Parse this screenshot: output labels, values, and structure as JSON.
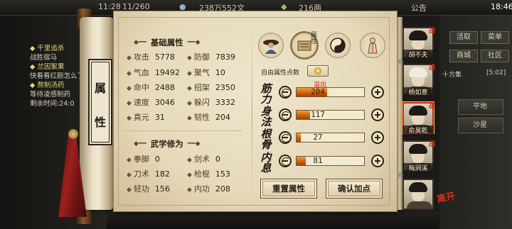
{
  "topbar": {
    "time_left": "11:28",
    "food": "11/260",
    "money": "238万552文",
    "gems": "216两",
    "notice": "公告",
    "clock": "18:46"
  },
  "quests": [
    {
      "text": "◆ 千里追杀",
      "highlight": true
    },
    {
      "text": "战胜宿马",
      "highlight": false
    },
    {
      "text": "◆ 兰因絮果",
      "highlight": true
    },
    {
      "text": "快看看红颜怎么了",
      "highlight": false
    },
    {
      "text": "◆ 熬制汤药",
      "highlight": true
    },
    {
      "text": "等待凌感制药",
      "highlight": false
    },
    {
      "text": "剩余时间:24:0",
      "highlight": false
    }
  ],
  "right_menu": {
    "buttons": [
      "活取",
      "菜单",
      "商城",
      "社区"
    ],
    "sub": [
      "十方集",
      "[5:02]"
    ],
    "locations": [
      "平地",
      "沙星"
    ]
  },
  "panel": {
    "title_chars": [
      "属",
      "性"
    ],
    "basic_title": "基础属性",
    "martial_title": "武学修为",
    "basic_stats": [
      {
        "label": "攻击",
        "value": "5778"
      },
      {
        "label": "防御",
        "value": "7839"
      },
      {
        "label": "气血",
        "value": "19492"
      },
      {
        "label": "聚气",
        "value": "10"
      },
      {
        "label": "命中",
        "value": "2488"
      },
      {
        "label": "招架",
        "value": "2350"
      },
      {
        "label": "速度",
        "value": "3046"
      },
      {
        "label": "躲闪",
        "value": "3332"
      },
      {
        "label": "真元",
        "value": "31"
      },
      {
        "label": "韧性",
        "value": "204"
      }
    ],
    "martial_stats": [
      {
        "label": "拳脚",
        "value": "0"
      },
      {
        "label": "剑术",
        "value": "0"
      },
      {
        "label": "刀术",
        "value": "182"
      },
      {
        "label": "枪棍",
        "value": "153"
      },
      {
        "label": "轻功",
        "value": "156"
      },
      {
        "label": "内功",
        "value": "208"
      }
    ],
    "tabs": [
      "人物",
      "属性",
      "武学",
      "经脉"
    ],
    "active_tab_label": "属性",
    "free_points_label": "自由属性点数",
    "overflow_label": "溢出",
    "attributes": [
      {
        "name": "筋力",
        "value": "204",
        "fill": 0.45
      },
      {
        "name": "身法",
        "value": "117",
        "fill": 0.2
      },
      {
        "name": "根骨",
        "value": "27",
        "fill": 0.06
      },
      {
        "name": "内息",
        "value": "81",
        "fill": 0.14
      }
    ],
    "reset_button": "重置属性",
    "confirm_button": "确认加点"
  },
  "roster": [
    {
      "name": "胡不夫",
      "mark": "战",
      "role": "侍"
    },
    {
      "name": "杨如意",
      "mark": "战",
      "role": ""
    },
    {
      "name": "俞昊乾",
      "mark": "战",
      "role": "",
      "selected": true
    },
    {
      "name": "梅涧溪",
      "mark": "战",
      "role": "侍"
    },
    {
      "name": "",
      "mark": "",
      "role": ""
    }
  ],
  "leave_label": "离开",
  "colors": {
    "bar_fill": "#d0600f",
    "overflow_red": "#c02a14",
    "selected_border": "#c92a16"
  }
}
